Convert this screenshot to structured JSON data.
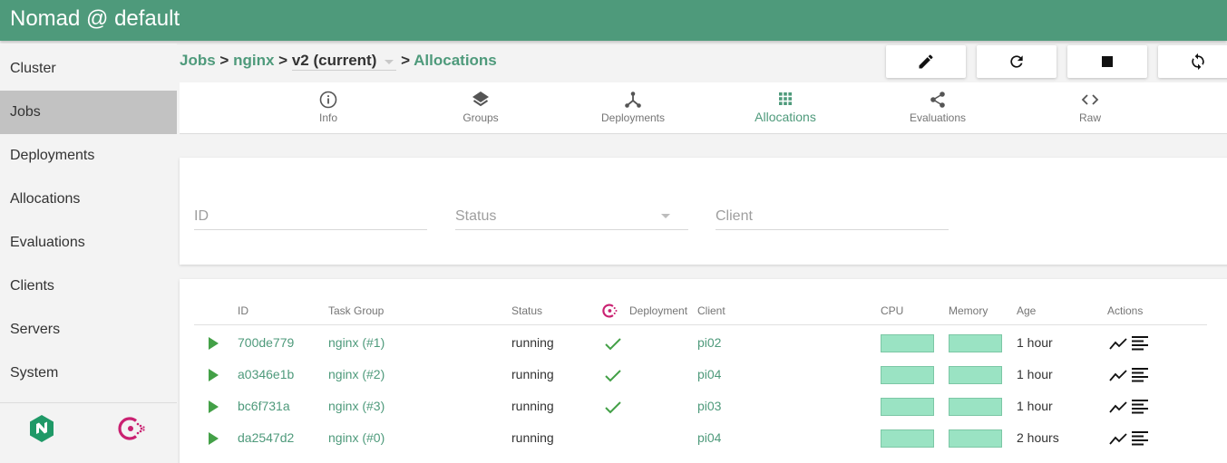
{
  "app": {
    "title": "Nomad @ default"
  },
  "sidebar": {
    "items": [
      {
        "label": "Cluster"
      },
      {
        "label": "Jobs"
      },
      {
        "label": "Deployments"
      },
      {
        "label": "Allocations"
      },
      {
        "label": "Evaluations"
      },
      {
        "label": "Clients"
      },
      {
        "label": "Servers"
      },
      {
        "label": "System"
      }
    ],
    "active": "Jobs"
  },
  "breadcrumb": {
    "jobs": "Jobs",
    "sep1": ">",
    "job": "nginx",
    "sep2": ">",
    "version": "v2 (current)",
    "sep3": ">",
    "page": "Allocations"
  },
  "toolbar": {
    "buttons": [
      {
        "icon": "pencil-icon"
      },
      {
        "icon": "refresh-icon"
      },
      {
        "icon": "stop-icon"
      },
      {
        "icon": "sync-icon"
      }
    ]
  },
  "tabs": [
    {
      "label": "Info",
      "icon": "info-icon"
    },
    {
      "label": "Groups",
      "icon": "layers-icon"
    },
    {
      "label": "Deployments",
      "icon": "deploy-icon"
    },
    {
      "label": "Allocations",
      "icon": "grid-icon"
    },
    {
      "label": "Evaluations",
      "icon": "share-icon"
    },
    {
      "label": "Raw",
      "icon": "code-icon"
    }
  ],
  "activeTab": "Allocations",
  "filters": {
    "id_placeholder": "ID",
    "status_placeholder": "Status",
    "client_placeholder": "Client"
  },
  "table": {
    "headers": {
      "id": "ID",
      "task_group": "Task Group",
      "status": "Status",
      "deployment": "Deployment",
      "client": "Client",
      "cpu": "CPU",
      "memory": "Memory",
      "age": "Age",
      "actions": "Actions"
    },
    "rows": [
      {
        "id": "700de779",
        "task_group": "nginx (#1)",
        "status": "running",
        "deployment_ok": true,
        "client": "pi02",
        "cpu": 1,
        "memory": 1,
        "age": "1 hour"
      },
      {
        "id": "a0346e1b",
        "task_group": "nginx (#2)",
        "status": "running",
        "deployment_ok": true,
        "client": "pi04",
        "cpu": 1,
        "memory": 1,
        "age": "1 hour"
      },
      {
        "id": "bc6f731a",
        "task_group": "nginx (#3)",
        "status": "running",
        "deployment_ok": true,
        "client": "pi03",
        "cpu": 1,
        "memory": 1,
        "age": "1 hour"
      },
      {
        "id": "da2547d2",
        "task_group": "nginx (#0)",
        "status": "running",
        "deployment_ok": false,
        "client": "pi04",
        "cpu": 1,
        "memory": 1,
        "age": "2 hours"
      }
    ]
  },
  "colors": {
    "brand": "#4e9a7b",
    "consul": "#ca2171",
    "running": "#43a047",
    "bar": "#9ae3c3"
  }
}
